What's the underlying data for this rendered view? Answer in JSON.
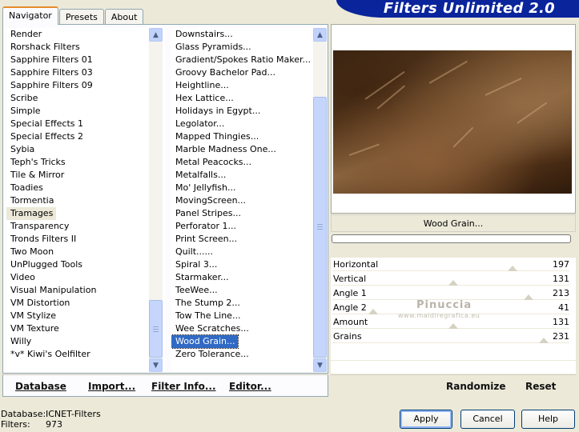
{
  "app": {
    "title": "Filters Unlimited 2.0"
  },
  "tabs": [
    {
      "label": "Navigator",
      "active": true
    },
    {
      "label": "Presets",
      "active": false
    },
    {
      "label": "About",
      "active": false
    }
  ],
  "categories": {
    "items": [
      "Render",
      "Rorshack Filters",
      "Sapphire Filters 01",
      "Sapphire Filters 03",
      "Sapphire Filters 09",
      "Scribe",
      "Simple",
      "Special Effects 1",
      "Special Effects 2",
      "Sybia",
      "Teph's Tricks",
      "Tile & Mirror",
      "Toadies",
      "Tormentia",
      "Tramages",
      "Transparency",
      "Tronds Filters II",
      "Two Moon",
      "UnPlugged Tools",
      "Video",
      "Visual Manipulation",
      "VM Distortion",
      "VM Stylize",
      "VM Texture",
      "Willy",
      "*v* Kiwi's Oelfilter"
    ],
    "selected": "Tramages"
  },
  "filters": {
    "items": [
      "Downstairs...",
      "Glass Pyramids...",
      "Gradient/Spokes Ratio Maker...",
      "Groovy Bachelor Pad...",
      "Heightline...",
      "Hex Lattice...",
      "Holidays in Egypt...",
      "Legolator...",
      "Mapped Thingies...",
      "Marble Madness One...",
      "Metal Peacocks...",
      "Metalfalls...",
      "Mo' Jellyfish...",
      "MovingScreen...",
      "Panel Stripes...",
      "Perforator 1...",
      "Print Screen...",
      "Quilt......",
      "Spiral 3...",
      "Starmaker...",
      "TeeWee...",
      "The Stump 2...",
      "Tow The Line...",
      "Wee Scratches...",
      "Wood Grain...",
      "Zero Tolerance..."
    ],
    "selected": "Wood Grain..."
  },
  "selected_filter_name": "Wood Grain...",
  "params": [
    {
      "label": "Horizontal",
      "value": "197",
      "level": 0.77
    },
    {
      "label": "Vertical",
      "value": "131",
      "level": 0.51
    },
    {
      "label": "Angle 1",
      "value": "213",
      "level": 0.84
    },
    {
      "label": "Angle 2",
      "value": "41",
      "level": 0.16
    },
    {
      "label": "Amount",
      "value": "131",
      "level": 0.51
    },
    {
      "label": "Grains",
      "value": "231",
      "level": 0.91
    }
  ],
  "watermark": {
    "line1": "Pinuccia",
    "line2": "www.maidiregrafica.eu"
  },
  "bottom_buttons": {
    "database": "Database",
    "import": "Import...",
    "filter_info": "Filter Info...",
    "editor": "Editor...",
    "randomize": "Randomize",
    "reset": "Reset"
  },
  "status": {
    "database_label": "Database:",
    "database_value": "ICNET-Filters",
    "filters_label": "Filters:",
    "filters_value": "973"
  },
  "dialog_buttons": {
    "apply": "Apply",
    "cancel": "Cancel",
    "help": "Help"
  },
  "colors": {
    "title_band": "#0a249c",
    "selection": "#316ac5",
    "tab_accent": "#e68b2c"
  },
  "icons": {
    "scroll_up": "chevron-up-icon",
    "scroll_down": "chevron-down-icon"
  }
}
